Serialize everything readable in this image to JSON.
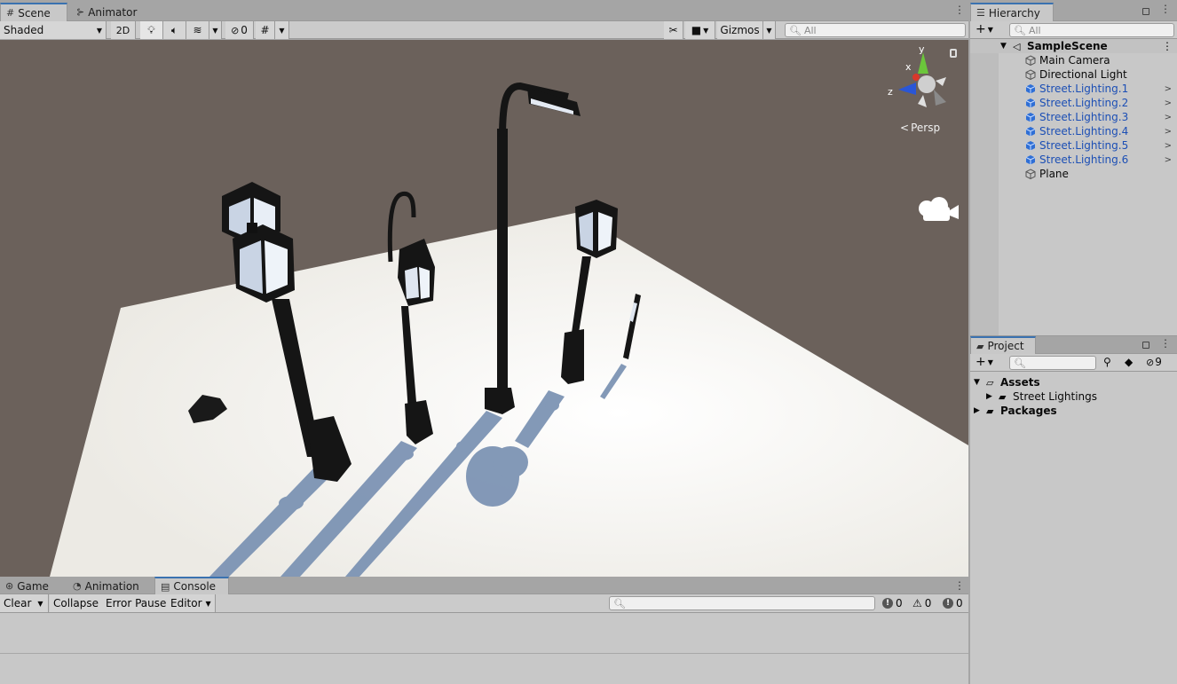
{
  "scene_panel": {
    "tabs": [
      {
        "label": "Scene",
        "icon": "grid-icon"
      },
      {
        "label": "Animator",
        "icon": "animator-icon"
      }
    ],
    "toolbar": {
      "shading_mode": "Shaded",
      "mode_2d": "2D",
      "hidden_count": "0",
      "gizmos_label": "Gizmos",
      "search_placeholder": "All"
    },
    "gizmo": {
      "axis_y": "y",
      "axis_x": "x",
      "axis_z": "z",
      "projection": "Persp"
    }
  },
  "hierarchy": {
    "title": "Hierarchy",
    "search_placeholder": "All",
    "scene_name": "SampleScene",
    "items": [
      {
        "label": "Main Camera",
        "type": "gameobject",
        "prefab": false
      },
      {
        "label": "Directional Light",
        "type": "gameobject",
        "prefab": false
      },
      {
        "label": "Street.Lighting.1",
        "type": "prefab",
        "prefab": true
      },
      {
        "label": "Street.Lighting.2",
        "type": "prefab",
        "prefab": true
      },
      {
        "label": "Street.Lighting.3",
        "type": "prefab",
        "prefab": true
      },
      {
        "label": "Street.Lighting.4",
        "type": "prefab",
        "prefab": true
      },
      {
        "label": "Street.Lighting.5",
        "type": "prefab",
        "prefab": true
      },
      {
        "label": "Street.Lighting.6",
        "type": "prefab",
        "prefab": true
      },
      {
        "label": "Plane",
        "type": "gameobject",
        "prefab": false
      }
    ]
  },
  "project": {
    "title": "Project",
    "hidden_count": "9",
    "tree": {
      "assets": "Assets",
      "street_lightings": "Street Lightings",
      "packages": "Packages"
    }
  },
  "console_panel": {
    "tabs": [
      {
        "label": "Game",
        "icon": "gamepad-icon"
      },
      {
        "label": "Animation",
        "icon": "animation-icon"
      },
      {
        "label": "Console",
        "icon": "console-icon"
      }
    ],
    "toolbar": {
      "clear": "Clear",
      "collapse": "Collapse",
      "error_pause": "Error Pause",
      "editor": "Editor"
    },
    "counts": {
      "info": "0",
      "warning": "0",
      "error": "0"
    }
  },
  "colors": {
    "accent": "#3a72b0",
    "prefab_blue": "#1c4fb5",
    "scene_bg": "#6b615b",
    "plane": "#f2f0ea"
  }
}
